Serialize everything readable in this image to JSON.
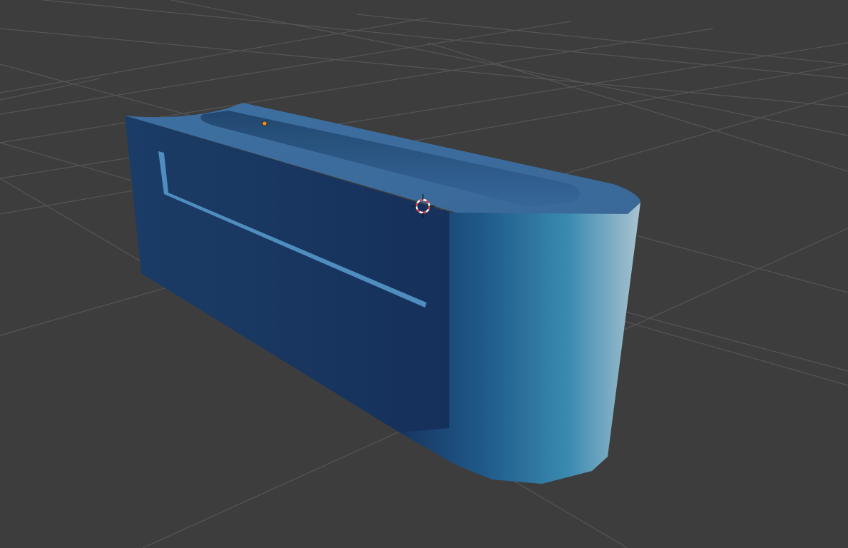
{
  "viewport": {
    "view": "3d-viewport",
    "background_color": "#3d3d3d",
    "grid_color": "#555555",
    "grid_visible": true
  },
  "object": {
    "shape": "rounded-bar-with-groove",
    "selected": false,
    "colors": {
      "top": "#3a6b9c",
      "front": "#1a3a62",
      "front_dark": "#142c4e",
      "end_cap_light": "#8fb0c4",
      "end_cap_mid": "#2e7ea6",
      "groove": "#2c5f91",
      "slot": "#4f8dbf"
    }
  },
  "origin_marker": {
    "color": "#e8901a",
    "icon": "object-origin-icon"
  },
  "cursor_3d": {
    "icon": "3d-cursor-icon",
    "ring_color": "#e33a3a",
    "ring_alt_color": "#ffffff"
  }
}
